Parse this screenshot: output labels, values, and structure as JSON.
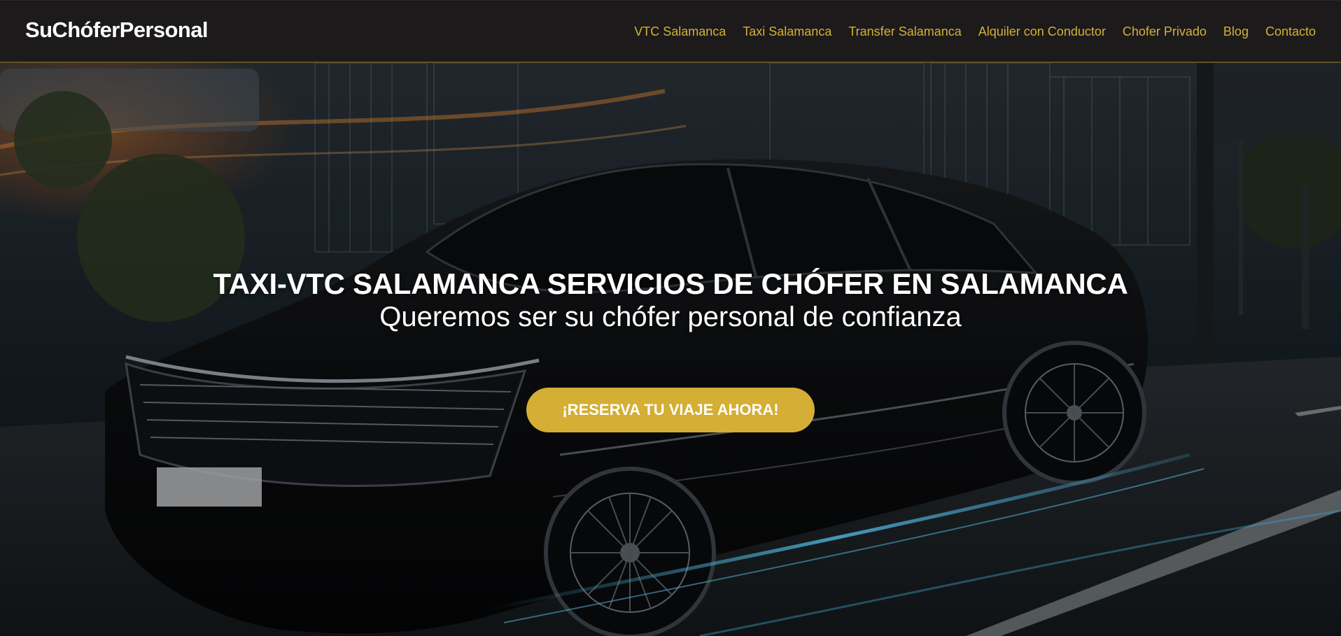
{
  "header": {
    "logo": "SuChóferPersonal",
    "nav": [
      "VTC Salamanca",
      "Taxi Salamanca",
      "Transfer Salamanca",
      "Alquiler con Conductor",
      "Chofer Privado",
      "Blog",
      "Contacto"
    ]
  },
  "hero": {
    "title": "TAXI-VTC SALAMANCA SERVICIOS DE CHÓFER EN SALAMANCA",
    "subtitle": "Queremos ser su chófer personal de confianza",
    "cta_label": "¡RESERVA TU VIAJE AHORA!",
    "background_image": "black-sedan-car-in-futuristic-city-street"
  },
  "colors": {
    "header_bg": "#1c1a1a",
    "nav_link": "#d3b13a",
    "cta_bg": "#d4ae35",
    "text": "#ffffff"
  }
}
